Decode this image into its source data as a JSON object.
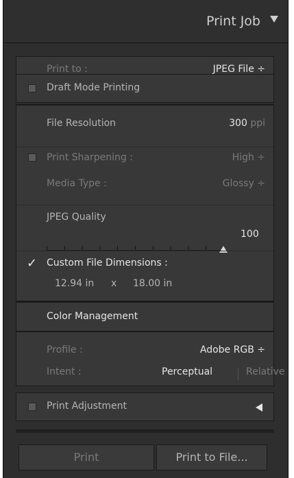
{
  "header": {
    "title": "Print Job"
  },
  "print_to": {
    "label": "Print to :",
    "value": "JPEG File ÷"
  },
  "draft": {
    "label": "Draft Mode Printing",
    "checked": false
  },
  "resolution": {
    "label": "File Resolution",
    "value": "300",
    "unit": "ppi"
  },
  "sharpening": {
    "label": "Print Sharpening :",
    "value": "High ÷",
    "checked": false
  },
  "media": {
    "label": "Media Type :",
    "value": "Glossy ÷"
  },
  "jpeg": {
    "label": "JPEG Quality",
    "value": "100"
  },
  "custom_dims": {
    "label": "Custom File Dimensions :",
    "checked": true,
    "width": "12.94 in",
    "x": "x",
    "height": "18.00 in"
  },
  "color_mgmt": {
    "title": "Color Management",
    "profile_label": "Profile :",
    "profile_value": "Adobe RGB ÷",
    "intent_label": "Intent :",
    "intent_perceptual": "Perceptual",
    "intent_relative": "Relative"
  },
  "adjustment": {
    "label": "Print Adjustment",
    "checked": false
  },
  "buttons": {
    "print": "Print",
    "print_to_file": "Print to File..."
  }
}
